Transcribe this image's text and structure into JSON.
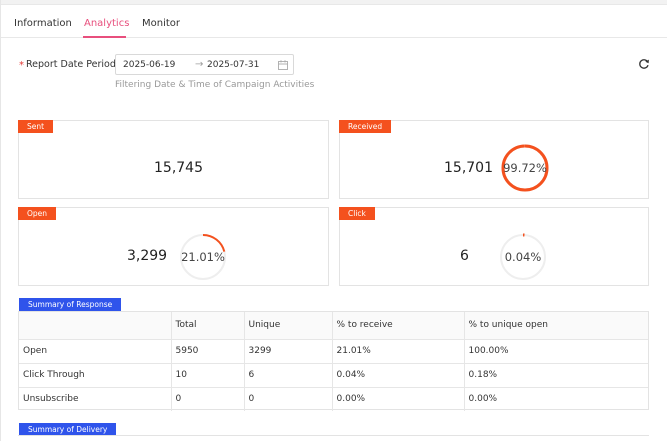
{
  "tabs": [
    {
      "label": "Information"
    },
    {
      "label": "Analytics"
    },
    {
      "label": "Monitor"
    }
  ],
  "active_tab": "Analytics",
  "filter": {
    "required_mark": "*",
    "label": "Report Date Period :",
    "start": "2025-06-19",
    "arrow": "→",
    "end": "2025-07-31",
    "help": "Filtering Date & Time of Campaign Activities"
  },
  "cards": {
    "sent": {
      "tag": "Sent",
      "value": "15,745"
    },
    "received": {
      "tag": "Received",
      "value": "15,701",
      "percent_text": "99.72%",
      "percent": 99.72
    },
    "open": {
      "tag": "Open",
      "value": "3,299",
      "percent_text": "21.01%",
      "percent": 21.01
    },
    "click": {
      "tag": "Click",
      "value": "6",
      "percent_text": "0.04%",
      "percent": 0.04
    }
  },
  "colors": {
    "accent": "#e84f7d",
    "tag_orange": "#f4511e",
    "tag_blue": "#2f54eb",
    "ring_track": "#eeeeee"
  },
  "summary_response": {
    "title": "Summary of Response",
    "columns": [
      "",
      "Total",
      "Unique",
      "% to receive",
      "% to unique open"
    ],
    "rows": [
      [
        "Open",
        "5950",
        "3299",
        "21.01%",
        "100.00%"
      ],
      [
        "Click Through",
        "10",
        "6",
        "0.04%",
        "0.18%"
      ],
      [
        "Unsubscribe",
        "0",
        "0",
        "0.00%",
        "0.00%"
      ]
    ]
  },
  "summary_delivery": {
    "title": "Summary of Delivery"
  }
}
